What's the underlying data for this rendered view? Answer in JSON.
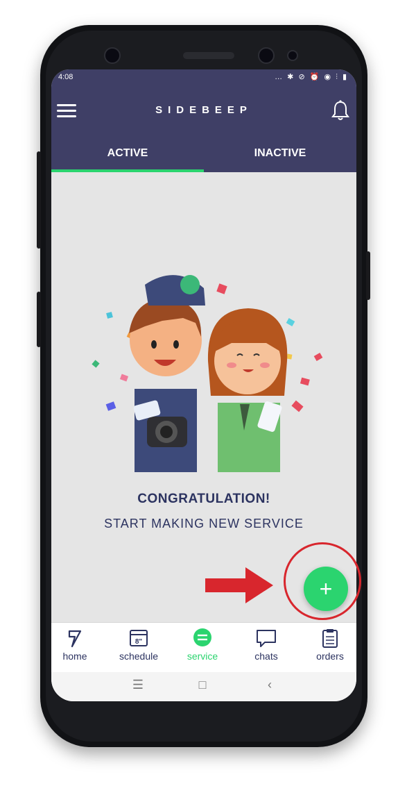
{
  "status_bar": {
    "time": "4:08",
    "icons": "…  ✱ ⊘ ⏰ ◉ ⫶ ▮"
  },
  "app_bar": {
    "title": "SIDEBEEP",
    "menu_icon": "hamburger-icon",
    "bell_icon": "bell-icon"
  },
  "tabs": [
    {
      "label": "ACTIVE",
      "active": true
    },
    {
      "label": "INACTIVE",
      "active": false
    }
  ],
  "empty_state": {
    "title": "CONGRATULATION!",
    "subtitle": "START MAKING NEW SERVICE"
  },
  "fab": {
    "label": "+"
  },
  "bottom_nav": [
    {
      "label": "home",
      "icon": "sidebeep-logo-icon",
      "active": false
    },
    {
      "label": "schedule",
      "icon": "calendar-icon",
      "active": false,
      "icon_text": "8\""
    },
    {
      "label": "service",
      "icon": "service-icon",
      "active": true
    },
    {
      "label": "chats",
      "icon": "chat-bubble-icon",
      "active": false
    },
    {
      "label": "orders",
      "icon": "clipboard-icon",
      "active": false
    }
  ],
  "system_nav": [
    {
      "icon": "recents-icon",
      "symbol": "☰"
    },
    {
      "icon": "home-square-icon",
      "symbol": "□"
    },
    {
      "icon": "back-icon",
      "symbol": "‹"
    }
  ],
  "colors": {
    "header": "#3f3f66",
    "accent": "#2bd46f",
    "text_dark": "#2c3360",
    "highlight": "#d8262d"
  }
}
